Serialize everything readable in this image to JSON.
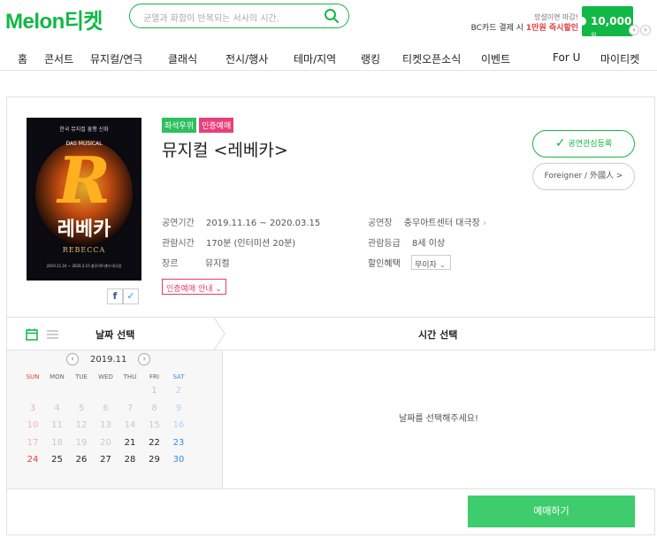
{
  "header": {
    "logo_melon": "Melon",
    "logo_ticket": "티켓",
    "search_placeholder": "균열과 화합이 반복되는 서사의 시간.",
    "promo_line1": "망설이면 마감!",
    "promo_line2_prefix": "BC카드 결제 시 ",
    "promo_line2_highlight": "1만원 즉시할인",
    "coupon_amount": "10,000",
    "coupon_unit": "원"
  },
  "nav": [
    "홈",
    "콘서트",
    "뮤지컬/연극",
    "클래식",
    "전시/행사",
    "테마/지역",
    "랭킹",
    "티켓오픈소식",
    "이벤트",
    "For U",
    "마이티켓"
  ],
  "show": {
    "tags": [
      {
        "label": "좌석우위",
        "color": "#2fbf5f"
      },
      {
        "label": "인증예매",
        "color": "#e8407a"
      }
    ],
    "title": "뮤지컬 <레베카>",
    "interest_button": "공연관심등록",
    "foreigner_button": "Foreigner / 外國人 >",
    "period_label": "공연기간",
    "period_value": "2019.11.16 ~ 2020.03.15",
    "runtime_label": "관람시간",
    "runtime_value": "170분 (인터미션 20분)",
    "genre_label": "장르",
    "genre_value": "뮤지컬",
    "venue_label": "공연장",
    "venue_value": "충무아트센터 대극장",
    "rating_label": "관람등급",
    "rating_value": "8세 이상",
    "discount_label": "할인혜택",
    "discount_value": "무이자",
    "cert_guide": "인증예매 안내"
  },
  "poster": {
    "top_text": "한국 뮤지컬 흥행 신화",
    "subtitle": "DAS MUSICAL",
    "big_letter": "R",
    "korean_title": "레베카",
    "english_title": "REBECCA",
    "dates": "2019.11.16 ~ 2020.3.15 충무아트센터 대극장"
  },
  "booking": {
    "date_select": "날짜 선택",
    "time_select": "시간 선택",
    "month": "2019.11",
    "weekdays": [
      "SUN",
      "MON",
      "TUE",
      "WED",
      "THU",
      "FRI",
      "SAT"
    ],
    "weeks": [
      [
        "",
        "",
        "",
        "",
        "",
        "1",
        "2"
      ],
      [
        "3",
        "4",
        "5",
        "6",
        "7",
        "8",
        "9"
      ],
      [
        "10",
        "11",
        "12",
        "13",
        "14",
        "15",
        "16"
      ],
      [
        "17",
        "18",
        "19",
        "20",
        "21",
        "22",
        "23"
      ],
      [
        "24",
        "25",
        "26",
        "27",
        "28",
        "29",
        "30"
      ]
    ],
    "disabled_until": 20,
    "time_placeholder": "날짜를 선택해주세요!",
    "book_button": "예매하기"
  },
  "colors": {
    "brand_green": "#11b845",
    "book_green": "#3ecc6c",
    "pink": "#e8407a",
    "sun_red": "#e83b3b",
    "sat_blue": "#3a8fe0"
  }
}
